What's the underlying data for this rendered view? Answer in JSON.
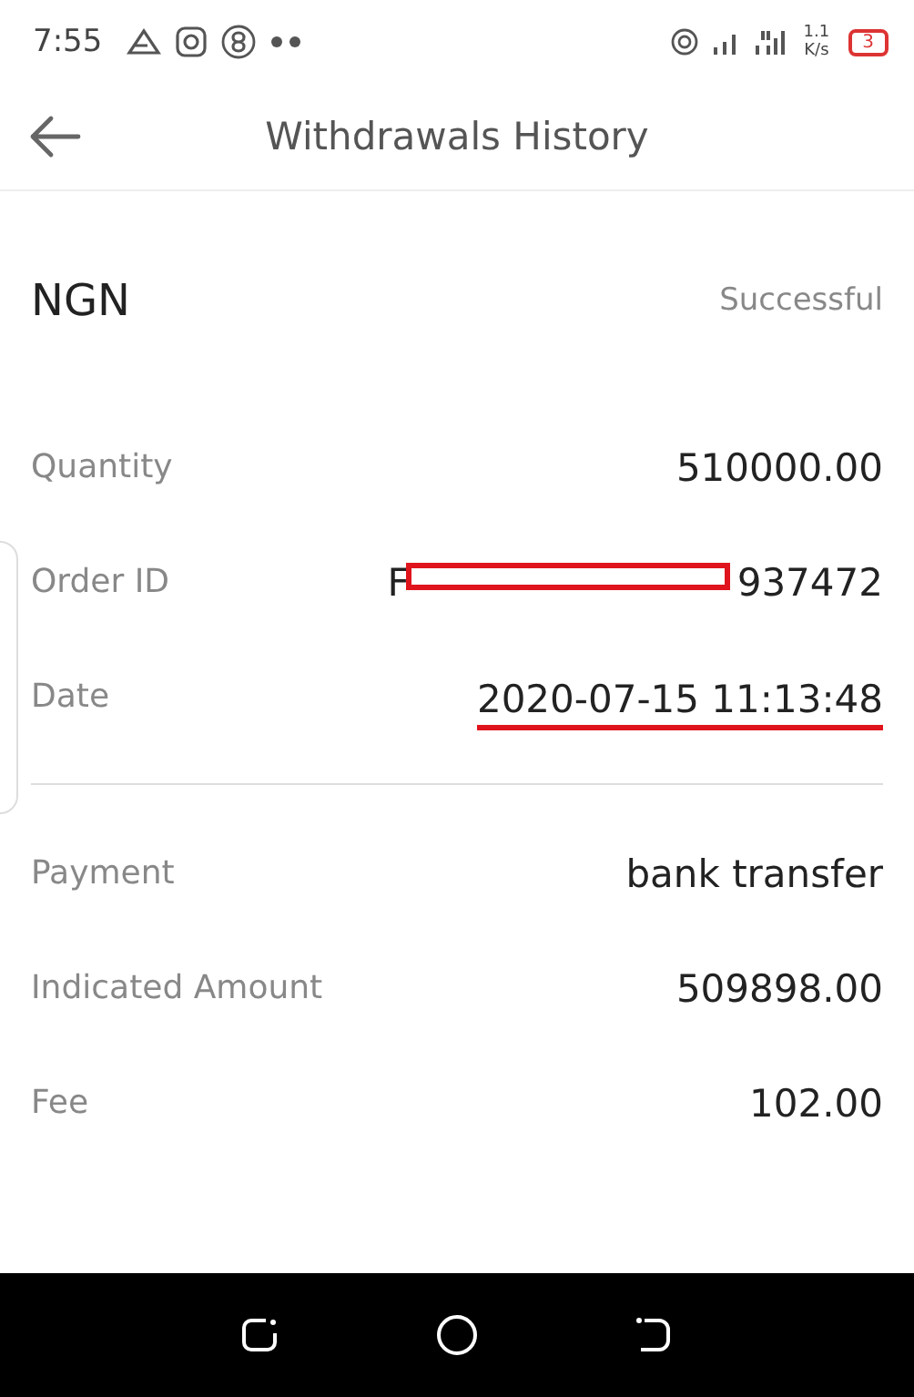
{
  "status_bar": {
    "time": "7:55",
    "speed_value": "1.1",
    "speed_unit": "K/s",
    "battery": "3"
  },
  "header": {
    "title": "Withdrawals History"
  },
  "summary": {
    "currency": "NGN",
    "status": "Successful"
  },
  "details": [
    {
      "label": "Quantity",
      "value": "510000.00",
      "kind": "plain"
    },
    {
      "label": "Order ID",
      "prefix": "F",
      "value": "937472",
      "kind": "redacted"
    },
    {
      "label": "Date",
      "value": "2020-07-15 11:13:48",
      "kind": "underlined"
    }
  ],
  "payment": [
    {
      "label": "Payment",
      "value": "bank transfer",
      "kind": "plain"
    },
    {
      "label": "Indicated Amount",
      "value": "509898.00",
      "kind": "plain"
    },
    {
      "label": "Fee",
      "value": "102.00",
      "kind": "plain"
    }
  ]
}
